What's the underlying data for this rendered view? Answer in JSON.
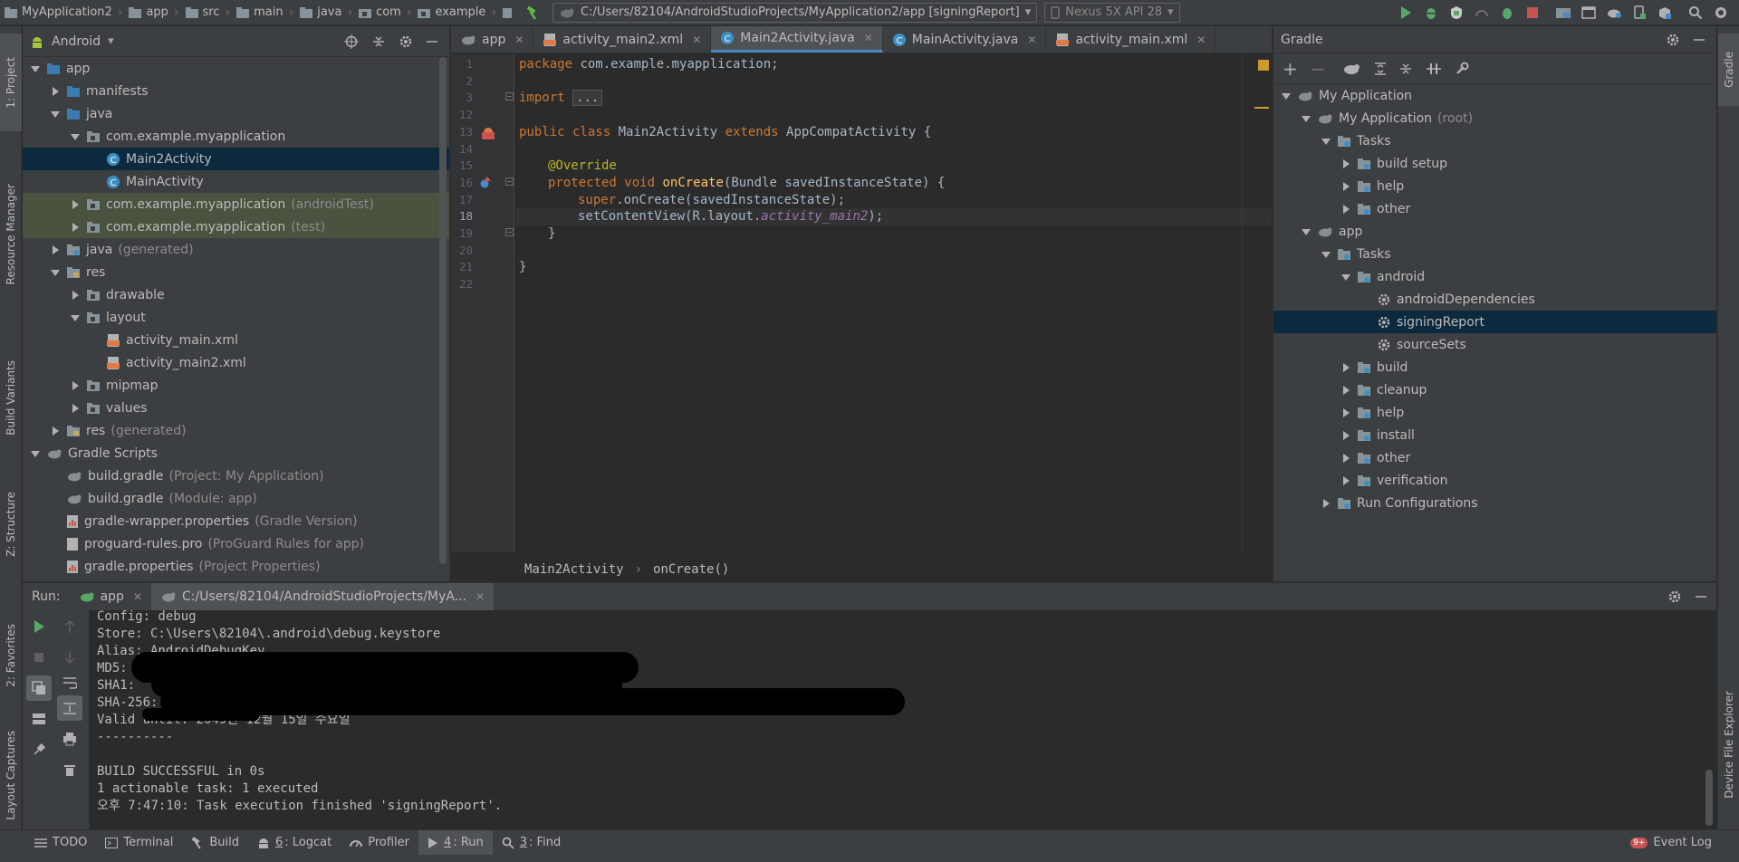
{
  "topbar": {
    "crumbs": [
      "MyApplication2",
      "app",
      "src",
      "main",
      "java",
      "com",
      "example"
    ],
    "run_config": "C:/Users/82104/AndroidStudioProjects/MyApplication2/app [signingReport]",
    "device": "Nexus 5X API 28"
  },
  "left_stripe": {
    "project": "1: Project",
    "resource_manager": "Resource Manager",
    "build_variants": "Build Variants",
    "structure": "Z: Structure",
    "favorites": "2: Favorites",
    "layout_captures": "Layout Captures"
  },
  "right_stripe": {
    "gradle": "Gradle",
    "device_file_explorer": "Device File Explorer"
  },
  "project_panel": {
    "view_mode": "Android",
    "tree": [
      {
        "label": "app",
        "hint": ""
      },
      {
        "label": "manifests",
        "hint": ""
      },
      {
        "label": "java",
        "hint": ""
      },
      {
        "label": "com.example.myapplication",
        "hint": ""
      },
      {
        "label": "Main2Activity",
        "hint": ""
      },
      {
        "label": "MainActivity",
        "hint": ""
      },
      {
        "label": "com.example.myapplication",
        "hint": "(androidTest)"
      },
      {
        "label": "com.example.myapplication",
        "hint": "(test)"
      },
      {
        "label": "java",
        "hint": "(generated)"
      },
      {
        "label": "res",
        "hint": ""
      },
      {
        "label": "drawable",
        "hint": ""
      },
      {
        "label": "layout",
        "hint": ""
      },
      {
        "label": "activity_main.xml",
        "hint": ""
      },
      {
        "label": "activity_main2.xml",
        "hint": ""
      },
      {
        "label": "mipmap",
        "hint": ""
      },
      {
        "label": "values",
        "hint": ""
      },
      {
        "label": "res",
        "hint": "(generated)"
      },
      {
        "label": "Gradle Scripts",
        "hint": ""
      },
      {
        "label": "build.gradle",
        "hint": "(Project: My Application)"
      },
      {
        "label": "build.gradle",
        "hint": "(Module: app)"
      },
      {
        "label": "gradle-wrapper.properties",
        "hint": "(Gradle Version)"
      },
      {
        "label": "proguard-rules.pro",
        "hint": "(ProGuard Rules for app)"
      },
      {
        "label": "gradle.properties",
        "hint": "(Project Properties)"
      }
    ]
  },
  "editor": {
    "tabs": [
      "app",
      "activity_main2.xml",
      "Main2Activity.java",
      "MainActivity.java",
      "activity_main.xml"
    ],
    "line_numbers": [
      "1",
      "2",
      "3",
      "12",
      "13",
      "14",
      "15",
      "16",
      "17",
      "18",
      "19",
      "20",
      "21",
      "22"
    ],
    "code": {
      "l1_kw": "package",
      "l1_rest": " com.example.myapplication;",
      "l3_kw": "import",
      "l3_fold": "...",
      "l13_kw": "public class",
      "l13_name": " Main2Activity ",
      "l13_kw2": "extends",
      "l13_rest": " AppCompatActivity {",
      "l15_ann": "@Override",
      "l16_kw": "protected void",
      "l16_fn": "onCreate",
      "l16_rest": "(Bundle savedInstanceState) {",
      "l17_kw": "super",
      "l17_rest": ".onCreate(savedInstanceState);",
      "l18_pre": "setContentView(R.layout.",
      "l18_it": "activity_main2",
      "l18_post": ");",
      "l19": "}",
      "l21": "}"
    },
    "breadcrumb": [
      "Main2Activity",
      "onCreate()"
    ]
  },
  "gradle_panel": {
    "title": "Gradle",
    "tree": [
      {
        "label": "My Application",
        "hint": ""
      },
      {
        "label": "My Application",
        "hint": "(root)"
      },
      {
        "label": "Tasks",
        "hint": ""
      },
      {
        "label": "build setup",
        "hint": ""
      },
      {
        "label": "help",
        "hint": ""
      },
      {
        "label": "other",
        "hint": ""
      },
      {
        "label": "app",
        "hint": ""
      },
      {
        "label": "Tasks",
        "hint": ""
      },
      {
        "label": "android",
        "hint": ""
      },
      {
        "label": "androidDependencies",
        "hint": ""
      },
      {
        "label": "signingReport",
        "hint": ""
      },
      {
        "label": "sourceSets",
        "hint": ""
      },
      {
        "label": "build",
        "hint": ""
      },
      {
        "label": "cleanup",
        "hint": ""
      },
      {
        "label": "help",
        "hint": ""
      },
      {
        "label": "install",
        "hint": ""
      },
      {
        "label": "other",
        "hint": ""
      },
      {
        "label": "verification",
        "hint": ""
      },
      {
        "label": "Run Configurations",
        "hint": ""
      }
    ]
  },
  "run_panel": {
    "label": "Run:",
    "tabs": [
      "app",
      "C:/Users/82104/AndroidStudioProjects/MyA..."
    ],
    "console": [
      "Config: debug",
      "Store: C:\\Users\\82104\\.android\\debug.keystore",
      "Alias: AndroidDebugKey",
      "MD5:",
      "SHA1:",
      "SHA-256:",
      "Valid until: 2049년 12월 15일 수요일",
      "----------",
      "",
      "BUILD SUCCESSFUL in 0s",
      "1 actionable task: 1 executed",
      "오후 7:47:10: Task execution finished 'signingReport'."
    ]
  },
  "bottombar": {
    "todo": "TODO",
    "terminal": "Terminal",
    "build": "Build",
    "logcat_num": "6",
    "logcat": ": Logcat",
    "profiler": "Profiler",
    "run_num": "4",
    "run": ": Run",
    "find_num": "3",
    "find": ": Find",
    "event_badge": "9+",
    "event_log": "Event Log"
  },
  "colors": {
    "keyword": "#cc7832",
    "annotation": "#bbb529",
    "method": "#ffc66d",
    "field": "#9876aa",
    "selection": "#0d293e"
  }
}
